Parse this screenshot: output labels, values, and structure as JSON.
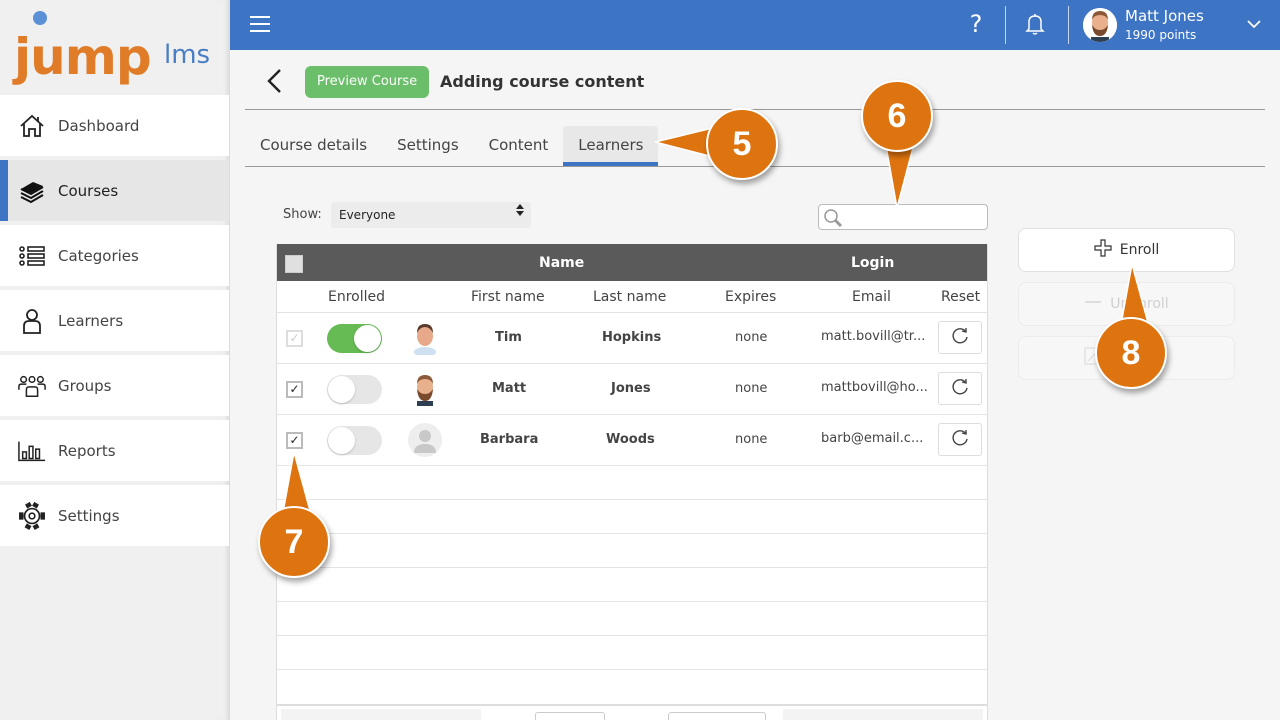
{
  "app": {
    "logo_main": "jump",
    "logo_suffix": "lms"
  },
  "sidebar": {
    "items": [
      {
        "label": "Dashboard",
        "icon": "house-icon",
        "active": false
      },
      {
        "label": "Courses",
        "icon": "books-icon",
        "active": true
      },
      {
        "label": "Categories",
        "icon": "list-icon",
        "active": false
      },
      {
        "label": "Learners",
        "icon": "person-icon",
        "active": false
      },
      {
        "label": "Groups",
        "icon": "group-icon",
        "active": false
      },
      {
        "label": "Reports",
        "icon": "bar-chart-icon",
        "active": false
      },
      {
        "label": "Settings",
        "icon": "gear-icon",
        "active": false
      }
    ]
  },
  "topbar": {
    "help_glyph": "?",
    "user": {
      "name": "Matt Jones",
      "points": "1990 points"
    }
  },
  "header": {
    "preview_label": "Preview Course",
    "title": "Adding course content"
  },
  "tabs": [
    {
      "label": "Course details",
      "active": false
    },
    {
      "label": "Settings",
      "active": false
    },
    {
      "label": "Content",
      "active": false
    },
    {
      "label": "Learners",
      "active": true
    }
  ],
  "filters": {
    "show_label": "Show:",
    "show_value": "Everyone",
    "search_value": "",
    "search_placeholder": ""
  },
  "table": {
    "group_headers": {
      "name": "Name",
      "login": "Login"
    },
    "columns": [
      "Enrolled",
      "First name",
      "Last name",
      "Expires",
      "Email",
      "Reset"
    ],
    "rows": [
      {
        "selected": false,
        "enrolled": true,
        "avatar": "tim-avatar",
        "first_name": "Tim",
        "last_name": "Hopkins",
        "expires": "none",
        "email": "matt.bovill@tr..."
      },
      {
        "selected": true,
        "enrolled": false,
        "avatar": "matt-avatar",
        "first_name": "Matt",
        "last_name": "Jones",
        "expires": "none",
        "email": "mattbovill@ho..."
      },
      {
        "selected": true,
        "enrolled": false,
        "avatar": "default-avatar",
        "first_name": "Barbara",
        "last_name": "Woods",
        "expires": "none",
        "email": "barb@email.c..."
      }
    ],
    "check_glyph": "✓"
  },
  "actions": {
    "enroll_label": "Enroll",
    "unenroll_label": "Unenroll",
    "third_label": ""
  },
  "callouts": [
    "5",
    "6",
    "7",
    "8"
  ],
  "colors": {
    "brand_blue": "#3e74c4",
    "logo_orange": "#e07b28",
    "preview_green": "#6bbf6b",
    "toggle_on": "#66bb55",
    "callout_orange": "#de7410",
    "table_header": "#5a5a5a"
  }
}
